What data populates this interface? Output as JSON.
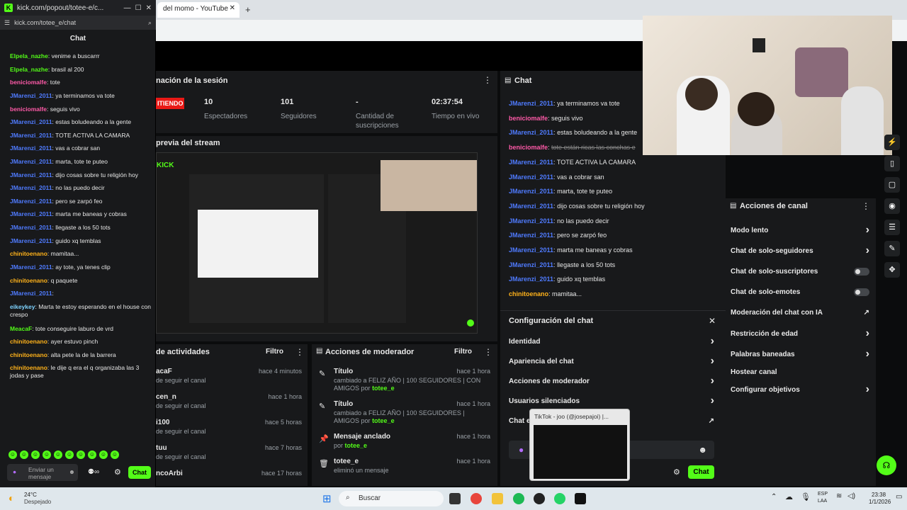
{
  "popout": {
    "title": "kick.com/popout/totee-e/c...",
    "url": "kick.com/totee_e/chat",
    "heading": "Chat",
    "messages": [
      {
        "user": "Elpela_nazhe",
        "text": "venime a buscarrr",
        "color": "#53fc18"
      },
      {
        "user": "Elpela_nazhe",
        "text": "brasil al 200",
        "color": "#53fc18"
      },
      {
        "user": "beniciomalfe",
        "text": "tote",
        "color": "#ff5aa8"
      },
      {
        "user": "JMarenzi_2011",
        "text": "ya terminamos va tote",
        "color": "#4f7bff"
      },
      {
        "user": "beniciomalfe",
        "text": "seguis vivo",
        "color": "#ff5aa8"
      },
      {
        "user": "JMarenzi_2011",
        "text": "estas boludeando a la gente",
        "color": "#4f7bff"
      },
      {
        "user": "JMarenzi_2011",
        "text": "TOTE ACTIVA LA CAMARA",
        "color": "#4f7bff"
      },
      {
        "user": "JMarenzi_2011",
        "text": "vas a cobrar san",
        "color": "#4f7bff"
      },
      {
        "user": "JMarenzi_2011",
        "text": "marta, tote te puteo",
        "color": "#4f7bff"
      },
      {
        "user": "JMarenzi_2011",
        "text": "dijo cosas sobre tu religión hoy",
        "color": "#4f7bff"
      },
      {
        "user": "JMarenzi_2011",
        "text": "no las puedo decir",
        "color": "#4f7bff"
      },
      {
        "user": "JMarenzi_2011",
        "text": "pero se zarpó feo",
        "color": "#4f7bff"
      },
      {
        "user": "JMarenzi_2011",
        "text": "marta me baneas y cobras",
        "color": "#4f7bff"
      },
      {
        "user": "JMarenzi_2011",
        "text": "llegaste a los 50 tots",
        "color": "#4f7bff"
      },
      {
        "user": "JMarenzi_2011",
        "text": "guido xq temblas",
        "color": "#4f7bff"
      },
      {
        "user": "chinitoenano",
        "text": "mamitaa...",
        "color": "#ffb21a"
      },
      {
        "user": "JMarenzi_2011",
        "text": "ay tote, ya tenes clip",
        "color": "#4f7bff"
      },
      {
        "user": "chinitoenano",
        "text": "q paquete",
        "color": "#ffb21a"
      },
      {
        "user": "JMarenzi_2011",
        "text": "",
        "color": "#4f7bff"
      },
      {
        "user": "eikeykey",
        "text": "Marta te estoy esperando en el house con crespo",
        "color": "#7fd3ff"
      },
      {
        "user": "MeacaF",
        "text": "tote conseguire laburo de vrd",
        "color": "#53fc18"
      },
      {
        "user": "chinitoenano",
        "text": "ayer estuvo pinch",
        "color": "#ffb21a"
      },
      {
        "user": "chinitoenano",
        "text": "alta pete la de la barrera",
        "color": "#ffb21a"
      },
      {
        "user": "chinitoenano",
        "text": "le dije q era el q organizaba las 3 jodas y pase",
        "color": "#ffb21a"
      }
    ],
    "input_placeholder": "Enviar un mensaje",
    "chat_button": "Chat"
  },
  "browser": {
    "tab_title": "del momo - YouTube",
    "new_tab": "+"
  },
  "session": {
    "title": "nación de la sesión",
    "live_badge": "ITIENDO",
    "stats": [
      {
        "value": "10",
        "label": "Espectadores"
      },
      {
        "value": "101",
        "label": "Seguidores"
      },
      {
        "value": "-",
        "label": "Cantidad de suscripciones"
      },
      {
        "value": "02:37:54",
        "label": "Tiempo en vivo"
      }
    ]
  },
  "preview": {
    "title": "previa del stream",
    "logo": "KICK"
  },
  "activity": {
    "title": "de actividades",
    "filter": "Filtro",
    "items": [
      {
        "user": "acaF",
        "sub": "de seguir el canal",
        "time": "hace 4 minutos"
      },
      {
        "user": "cen_n",
        "sub": "de seguir el canal",
        "time": "hace 1 hora"
      },
      {
        "user": "i100",
        "sub": "de seguir el canal",
        "time": "hace 5 horas"
      },
      {
        "user": "tuu",
        "sub": "de seguir el canal",
        "time": "hace 7 horas"
      },
      {
        "user": "ncoArbi",
        "sub": "",
        "time": "hace 17 horas"
      }
    ]
  },
  "mod_actions": {
    "title": "Acciones de moderador",
    "filter": "Filtro",
    "items": [
      {
        "title": "Título",
        "desc": "cambiado a FELIZ AÑO | 100 SEGUIDORES | CON AMIGOS",
        "by": "por",
        "user": "totee_e",
        "time": "hace 1 hora"
      },
      {
        "title": "Título",
        "desc": "cambiado a FELIZ AÑO | 100 SEGUIDORES | AMIGOS",
        "by": "por",
        "user": "totee_e",
        "time": "hace 1 hora"
      },
      {
        "title": "Mensaje anclado",
        "desc": "",
        "by": "por",
        "user": "totee_e",
        "time": "hace 1 hora"
      },
      {
        "title": "totee_e",
        "desc": "eliminó un mensaje",
        "by": "",
        "user": "",
        "time": "hace 1 hora"
      }
    ]
  },
  "chat": {
    "title": "Chat",
    "messages": [
      {
        "user": "JMarenzi_2011",
        "text": "ya terminamos va tote",
        "color": "#4f7bff"
      },
      {
        "user": "beniciomalfe",
        "text": "seguis vivo",
        "color": "#ff5aa8"
      },
      {
        "user": "JMarenzi_2011",
        "text": "estas boludeando a la gente",
        "color": "#4f7bff"
      },
      {
        "user": "beniciomalfe",
        "text": "tote están ricas las conchas e",
        "color": "#ff5aa8"
      },
      {
        "user": "JMarenzi_2011",
        "text": "TOTE ACTIVA LA CAMARA",
        "color": "#4f7bff"
      },
      {
        "user": "JMarenzi_2011",
        "text": "vas a cobrar san",
        "color": "#4f7bff"
      },
      {
        "user": "JMarenzi_2011",
        "text": "marta, tote te puteo",
        "color": "#4f7bff"
      },
      {
        "user": "JMarenzi_2011",
        "text": "dijo cosas sobre tu religión hoy",
        "color": "#4f7bff"
      },
      {
        "user": "JMarenzi_2011",
        "text": "no las puedo decir",
        "color": "#4f7bff"
      },
      {
        "user": "JMarenzi_2011",
        "text": "pero se zarpó feo",
        "color": "#4f7bff"
      },
      {
        "user": "JMarenzi_2011",
        "text": "marta me baneas y cobras",
        "color": "#4f7bff"
      },
      {
        "user": "JMarenzi_2011",
        "text": "llegaste a los 50 tots",
        "color": "#4f7bff"
      },
      {
        "user": "JMarenzi_2011",
        "text": "guido xq temblas",
        "color": "#4f7bff"
      },
      {
        "user": "chinitoenano",
        "text": "mamitaa...",
        "color": "#ffb21a"
      }
    ],
    "chat_button": "Chat"
  },
  "chat_config": {
    "title": "Configuración del chat",
    "items": [
      "Identidad",
      "Apariencia del chat",
      "Acciones de moderador",
      "Usuarios silenciados",
      "Chat e"
    ]
  },
  "tiktok_preview": {
    "title": "TikTok - joo (@josepajoi) |..."
  },
  "channel_actions": {
    "title": "Acciones de canal",
    "items": [
      {
        "label": "Modo lento",
        "kind": "arrow"
      },
      {
        "label": "Chat de solo-seguidores",
        "kind": "arrow"
      },
      {
        "label": "Chat de solo-suscriptores",
        "kind": "toggle"
      },
      {
        "label": "Chat de solo-emotes",
        "kind": "toggle"
      },
      {
        "label": "Moderación del chat con IA",
        "kind": "external"
      },
      {
        "label": "Restricción de edad",
        "kind": "arrow"
      },
      {
        "label": "Palabras baneadas",
        "kind": "arrow"
      },
      {
        "label": "Hostear canal",
        "kind": "none"
      },
      {
        "label": "Configurar objetivos",
        "kind": "arrow"
      }
    ]
  },
  "taskbar": {
    "weather_temp": "24°C",
    "weather_desc": "Despejado",
    "search": "Buscar",
    "lang": "ESP",
    "lang2": "LAA",
    "time": "23:38",
    "date": "1/1/2026"
  }
}
